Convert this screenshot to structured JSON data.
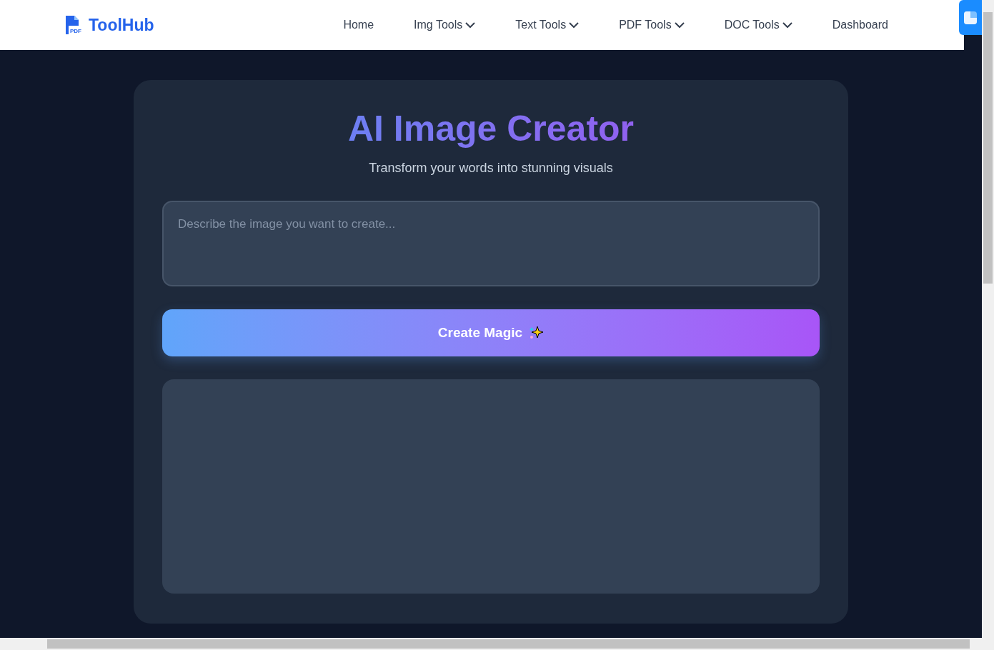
{
  "brand": {
    "name": "ToolHub",
    "icon_label": "PDF"
  },
  "nav": [
    {
      "label": "Home",
      "dropdown": false
    },
    {
      "label": "Img Tools",
      "dropdown": true
    },
    {
      "label": "Text Tools",
      "dropdown": true
    },
    {
      "label": "PDF Tools",
      "dropdown": true
    },
    {
      "label": "DOC Tools",
      "dropdown": true
    },
    {
      "label": "Dashboard",
      "dropdown": false
    }
  ],
  "card": {
    "title": "AI Image Creator",
    "subtitle": "Transform your words into stunning visuals",
    "prompt": {
      "placeholder": "Describe the image you want to create..."
    },
    "button": "Create Magic"
  }
}
